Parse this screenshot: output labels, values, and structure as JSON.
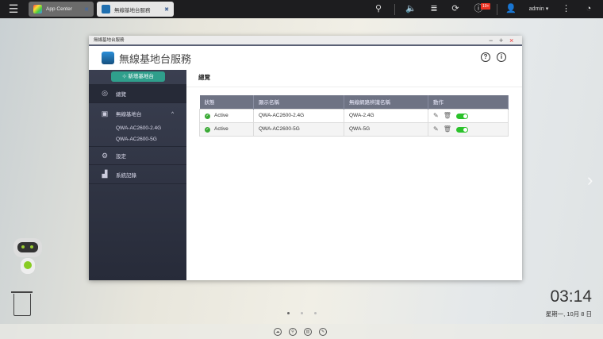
{
  "topbar": {
    "tabs": [
      {
        "label": "App Center"
      },
      {
        "label": "無線基地台服務"
      }
    ],
    "user": "admin ▾",
    "notifications": "10+",
    "icons": [
      "menu-icon",
      "search-icon",
      "volume-icon",
      "stack-icon",
      "sync-icon",
      "info-icon",
      "user-icon",
      "more-icon",
      "dashboard-icon"
    ]
  },
  "window": {
    "titlebar": "無線基地台服務",
    "app_title": "無線基地台服務",
    "controls": [
      "−",
      "+",
      "×"
    ],
    "help": "?",
    "info": "i"
  },
  "sidebar": {
    "add_button": "新增基地台",
    "items": [
      {
        "label": "總覽",
        "icon": "dashboard-icon"
      },
      {
        "label": "無線基地台",
        "icon": "device-icon",
        "chevron": "^"
      },
      {
        "label": "設定",
        "icon": "gear-icon"
      },
      {
        "label": "系統記錄",
        "icon": "chart-icon"
      }
    ],
    "subitems": [
      "QWA-AC2600-2.4G",
      "QWA-AC2600-5G"
    ]
  },
  "main": {
    "heading": "總覽",
    "columns": [
      "狀態",
      "顯示名稱",
      "無線網路辨識名稱",
      "動作"
    ],
    "rows": [
      {
        "status": "Active",
        "name": "QWA-AC2600-2.4G",
        "ssid": "QWA-2.4G",
        "enabled": true
      },
      {
        "status": "Active",
        "name": "QWA-AC2600-5G",
        "ssid": "QWA-5G",
        "enabled": true
      }
    ]
  },
  "desktop": {
    "time": "03:14",
    "date": "星期一, 10月 8 日",
    "page_dots": 3,
    "active_page": 1
  },
  "colors": {
    "accent": "#2f9f8c",
    "sidebar": "#2f3342",
    "toggle_on": "#2bc22b",
    "table_header": "#6e7384"
  }
}
